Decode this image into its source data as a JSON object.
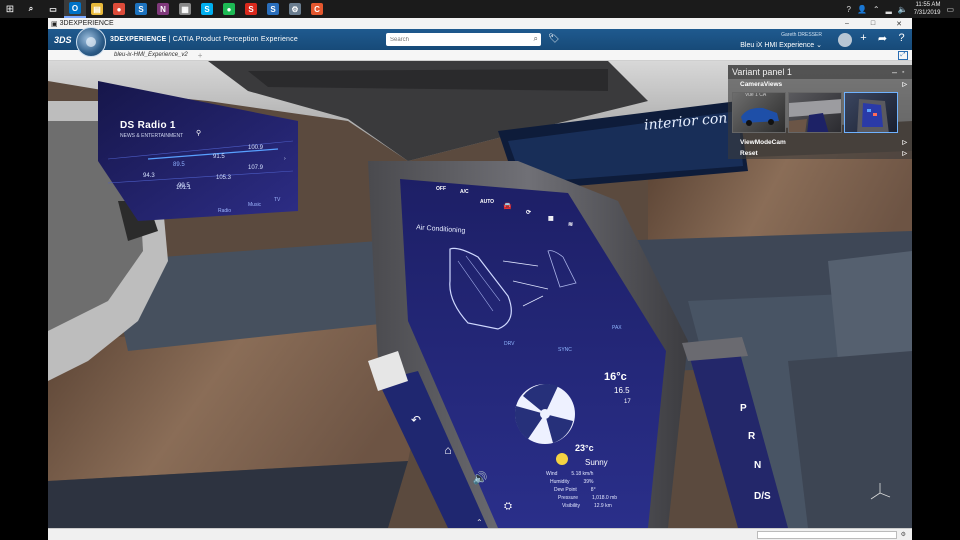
{
  "taskbar": {
    "icons": [
      {
        "name": "search-icon",
        "glyph": "⌕"
      },
      {
        "name": "task-view-icon",
        "glyph": "▭"
      },
      {
        "name": "outlook-icon",
        "glyph": "O",
        "color": "#0072c6"
      },
      {
        "name": "file-explorer-icon",
        "glyph": "▤",
        "color": "#e8b93a"
      },
      {
        "name": "chrome-icon",
        "glyph": "●",
        "color": "#dd4b39"
      },
      {
        "name": "skype-business-icon",
        "glyph": "S",
        "color": "#1e73be"
      },
      {
        "name": "onenote-icon",
        "glyph": "N",
        "color": "#80397b"
      },
      {
        "name": "app-icon",
        "glyph": "▦",
        "color": "#888888"
      },
      {
        "name": "skype-icon",
        "glyph": "S",
        "color": "#00aff0"
      },
      {
        "name": "spotify-icon",
        "glyph": "●",
        "color": "#1db954"
      },
      {
        "name": "solidworks-icon",
        "glyph": "S",
        "color": "#da291c"
      },
      {
        "name": "solidworks-alt-icon",
        "glyph": "S",
        "color": "#2a6ebb"
      },
      {
        "name": "tool-icon",
        "glyph": "⚙",
        "color": "#6a7d8f"
      },
      {
        "name": "catia-icon",
        "glyph": "C",
        "color": "#e4572e"
      }
    ],
    "time": "11:55 AM",
    "date": "7/31/2019"
  },
  "window": {
    "title": "3DEXPERIENCE",
    "controls": [
      "–",
      "□",
      "✕"
    ]
  },
  "topbar": {
    "brand": "3DS",
    "product_prefix": "3DEXPERIENCE",
    "product_suffix": " | CATIA Product Perception Experience",
    "search_placeholder": "Search",
    "user_name": "Gareth DRESSER",
    "space_name": "Bleu iX HMI Experience ⌄"
  },
  "tabs": [
    {
      "label": "bleu-ix-HMI_Experience_v2"
    }
  ],
  "scene": {
    "radio_title": "DS Radio 1",
    "radio_subtitle": "NEWS & ENTERTAINMENT",
    "frequencies": [
      "89.5",
      "91.5",
      "100.9",
      "94.3",
      "99.5",
      "107.9",
      "101.1",
      "105.3",
      "88.7"
    ],
    "radio_nav": [
      "Radio",
      "Music",
      "TV"
    ],
    "interior_label": "interior con",
    "ac_title": "Air Conditioning",
    "ac_top_items": [
      "OFF",
      "A/C",
      "AUTO"
    ],
    "ac_modes": [
      "DRV",
      "SYNC",
      "PAX"
    ],
    "temp_main": "16°c",
    "temp_small": "16.5",
    "temp_tiny": "17",
    "weather_temp": "23°c",
    "weather_cond": "Sunny",
    "weather_rows": [
      {
        "label": "Wind",
        "value": "5.18 km/h"
      },
      {
        "label": "Humidity",
        "value": "39%"
      },
      {
        "label": "Dew Point",
        "value": "8°"
      },
      {
        "label": "Pressure",
        "value": "1,018.0 mb"
      },
      {
        "label": "Visibility",
        "value": "12.9 km"
      }
    ],
    "gears": [
      "P",
      "R",
      "N",
      "D/S"
    ]
  },
  "variant_panel": {
    "title": "Variant panel 1",
    "camera_views_label": "CameraViews",
    "thumb_caption": "Vue 1 CA",
    "view_mode_label": "ViewModeCam",
    "reset_label": "Reset"
  }
}
